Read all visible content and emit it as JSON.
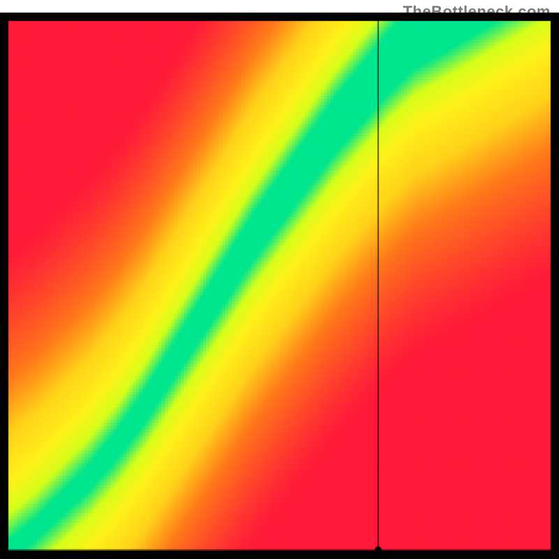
{
  "attribution": "TheBottleneck.com",
  "chart_data": {
    "type": "heatmap",
    "title": "",
    "xlabel": "",
    "ylabel": "",
    "xlim": [
      0,
      1
    ],
    "ylim": [
      0,
      1
    ],
    "axes_drawn": false,
    "border": {
      "color": "#000000",
      "width": 12
    },
    "marker": {
      "x": 0.682,
      "y": 0.0,
      "lines": "crosshair-to-edges"
    },
    "colorscale": [
      {
        "t": 0.0,
        "hex": "#ff1a3a"
      },
      {
        "t": 0.35,
        "hex": "#ff7a1a"
      },
      {
        "t": 0.55,
        "hex": "#ffd21a"
      },
      {
        "t": 0.75,
        "hex": "#fff21a"
      },
      {
        "t": 0.88,
        "hex": "#d6ff1a"
      },
      {
        "t": 1.0,
        "hex": "#00e68f"
      }
    ],
    "ridge": {
      "comment": "Approximate centerline of the green optimal band, sampled as (x, y) in normalized [0,1] coords. Band half-width ~0.04–0.06 normalized, slightly wider at top.",
      "points_x": [
        0.0,
        0.05,
        0.1,
        0.15,
        0.2,
        0.25,
        0.3,
        0.35,
        0.4,
        0.45,
        0.5,
        0.55,
        0.6,
        0.65,
        0.7,
        0.75,
        0.8
      ],
      "points_y": [
        0.0,
        0.04,
        0.09,
        0.14,
        0.2,
        0.27,
        0.35,
        0.43,
        0.51,
        0.59,
        0.66,
        0.73,
        0.8,
        0.86,
        0.92,
        0.97,
        1.0
      ],
      "half_width_bottom": 0.018,
      "half_width_top": 0.06
    }
  }
}
